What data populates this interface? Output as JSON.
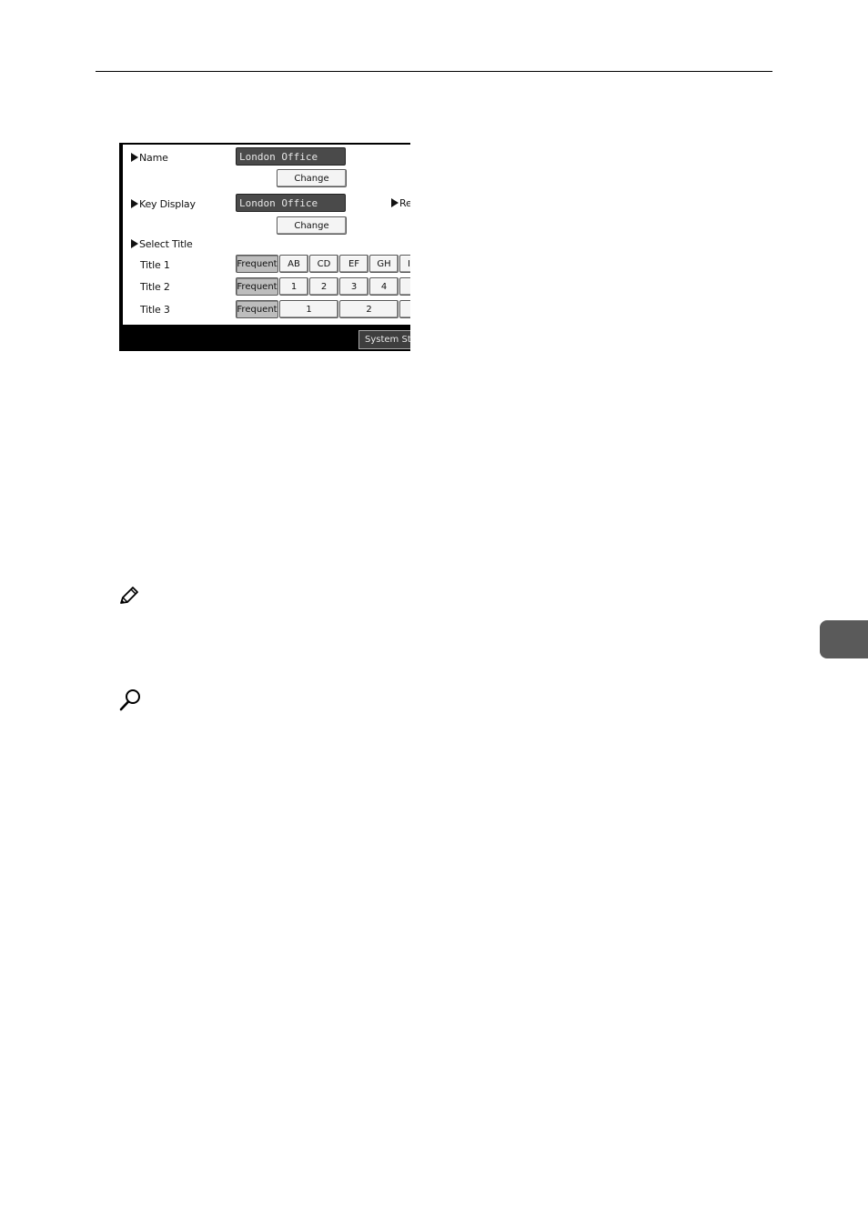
{
  "screen": {
    "name_label": "Name",
    "name_value": "London Office",
    "name_change": "Change",
    "key_display_label": "Key Display",
    "key_display_value": "London Office",
    "key_display_change": "Change",
    "right_label_partial": "Re",
    "select_title_label": "Select Title",
    "title_rows": [
      {
        "label": "Title 1",
        "frequent": "Frequent",
        "keys": [
          "AB",
          "CD",
          "EF",
          "GH",
          "I"
        ]
      },
      {
        "label": "Title 2",
        "frequent": "Frequent",
        "keys": [
          "1",
          "2",
          "3",
          "4",
          ""
        ]
      },
      {
        "label": "Title 3",
        "frequent": "Frequent",
        "keys": [
          "1",
          "2",
          ""
        ]
      }
    ],
    "system_status": "System Status"
  },
  "icons": {
    "note": "pencil-note-icon",
    "reference": "magnifier-reference-icon"
  }
}
